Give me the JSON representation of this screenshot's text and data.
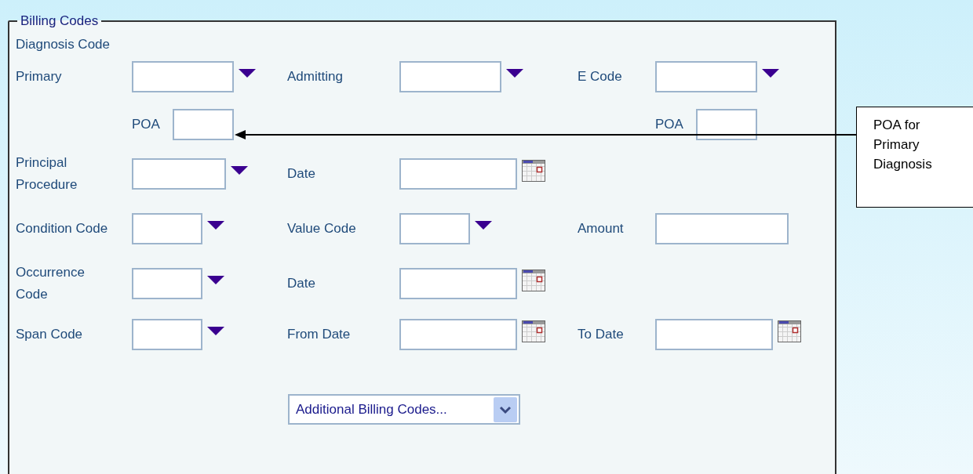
{
  "section": {
    "title": "Billing Codes",
    "subtitle": "Diagnosis Code"
  },
  "rows": [
    {
      "kind": "fields",
      "items": [
        {
          "label": "Primary",
          "kind": "dropdown"
        },
        {
          "label": "Admitting",
          "kind": "dropdown"
        },
        {
          "label": "E Code",
          "kind": "dropdown"
        }
      ]
    },
    {
      "kind": "poa",
      "items": [
        {
          "label": "POA"
        },
        {
          "label": "POA"
        }
      ]
    },
    {
      "kind": "fields",
      "items": [
        {
          "label": "Principal Procedure",
          "kind": "dropdown"
        },
        {
          "label": "Date",
          "kind": "date"
        }
      ]
    },
    {
      "kind": "fields",
      "items": [
        {
          "label": "Condition Code",
          "kind": "dropdown"
        },
        {
          "label": "Value Code",
          "kind": "dropdown"
        },
        {
          "label": "Amount",
          "kind": "text"
        }
      ]
    },
    {
      "kind": "fields",
      "items": [
        {
          "label": "Occurrence Code",
          "kind": "dropdown"
        },
        {
          "label": "Date",
          "kind": "date"
        }
      ]
    },
    {
      "kind": "fields",
      "items": [
        {
          "label": "Span Code",
          "kind": "dropdown"
        },
        {
          "label": "From Date",
          "kind": "date"
        },
        {
          "label": "To Date",
          "kind": "date"
        }
      ]
    }
  ],
  "more_button": {
    "label": "Additional Billing Codes..."
  },
  "callout": {
    "text": "POA for Primary Diagnosis"
  }
}
